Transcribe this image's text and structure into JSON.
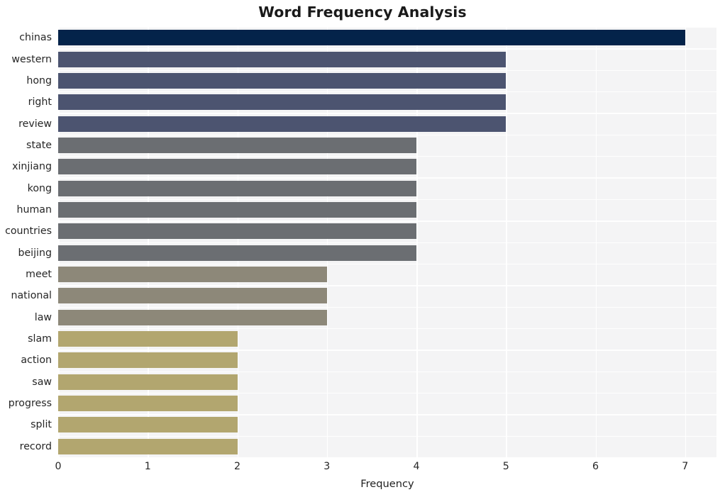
{
  "chart_data": {
    "type": "bar",
    "orientation": "horizontal",
    "title": "Word Frequency Analysis",
    "xlabel": "Frequency",
    "ylabel": "",
    "xlim": [
      0,
      7.35
    ],
    "xticks": [
      "0",
      "1",
      "2",
      "3",
      "4",
      "5",
      "6",
      "7"
    ],
    "xtick_values": [
      0,
      1,
      2,
      3,
      4,
      5,
      6,
      7
    ],
    "grid": true,
    "grid_color": "#ffffff",
    "plot_background": "#f4f4f5",
    "figure_background": "#ffffff",
    "legend": null,
    "categories": [
      "chinas",
      "western",
      "hong",
      "right",
      "review",
      "state",
      "xinjiang",
      "kong",
      "human",
      "countries",
      "beijing",
      "meet",
      "national",
      "law",
      "slam",
      "action",
      "saw",
      "progress",
      "split",
      "record"
    ],
    "values": [
      7,
      5,
      5,
      5,
      5,
      4,
      4,
      4,
      4,
      4,
      4,
      3,
      3,
      3,
      2,
      2,
      2,
      2,
      2,
      2
    ],
    "bar_colors": [
      "#04234a",
      "#4c5470",
      "#4c5470",
      "#4c5470",
      "#4c5470",
      "#6b6e72",
      "#6b6e72",
      "#6b6e72",
      "#6b6e72",
      "#6b6e72",
      "#6b6e72",
      "#8d8879",
      "#8d8879",
      "#8d8879",
      "#b2a66f",
      "#b2a66f",
      "#b2a66f",
      "#b2a66f",
      "#b2a66f",
      "#b2a66f"
    ],
    "palette_name": "cividis-like",
    "colors": {
      "rank1": "#04234a",
      "rank2": "#4c5470",
      "rank3": "#6b6e72",
      "rank4": "#8d8879",
      "rank5": "#b2a66f",
      "title": "#1a1a1a",
      "tick_label": "#262626"
    }
  }
}
